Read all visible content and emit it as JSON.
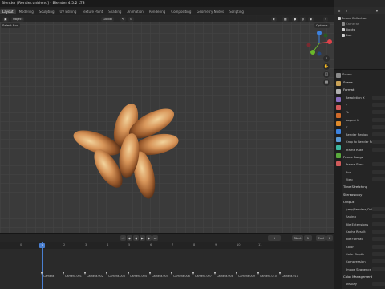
{
  "window": {
    "title": "Blender [Render.unblend] - Blender 4.5.2 LTS"
  },
  "workspace_tabs": [
    {
      "label": "Layout",
      "active": true
    },
    {
      "label": "Modeling",
      "active": false
    },
    {
      "label": "Sculpting",
      "active": false
    },
    {
      "label": "UV Editing",
      "active": false
    },
    {
      "label": "Texture Paint",
      "active": false
    },
    {
      "label": "Shading",
      "active": false
    },
    {
      "label": "Animation",
      "active": false
    },
    {
      "label": "Rendering",
      "active": false
    },
    {
      "label": "Compositing",
      "active": false
    },
    {
      "label": "Geometry Nodes",
      "active": false
    },
    {
      "label": "Scripting",
      "active": false
    }
  ],
  "viewport": {
    "header": {
      "global_label": "Global",
      "options_label": "Options"
    },
    "select_box_label": "Select Box",
    "object_menu": "Object",
    "gizmo_axes": [
      "X",
      "Y",
      "Z"
    ]
  },
  "outliner": {
    "rows": [
      {
        "label": "Scene Collection",
        "icon": "collection-icon",
        "color": "#cfcfcf"
      },
      {
        "label": "Cameras",
        "icon": "camera-icon",
        "color": "#8a8a8a"
      },
      {
        "label": "Lights",
        "icon": "light-icon",
        "color": "#cfcfcf"
      },
      {
        "label": "Bun",
        "icon": "mesh-icon",
        "color": "#cfcfcf"
      }
    ]
  },
  "properties": {
    "context": "Scene",
    "rows": [
      {
        "label": "Scene",
        "section": true
      },
      {
        "label": "Format",
        "section": true
      },
      {
        "label": "Resolution X",
        "section": false
      },
      {
        "label": "Y",
        "section": false
      },
      {
        "label": "%",
        "section": false
      },
      {
        "label": "Aspect X",
        "section": false
      },
      {
        "label": "Y",
        "section": false
      },
      {
        "label": "Render Region",
        "section": false
      },
      {
        "label": "Crop to Render Region",
        "section": false
      },
      {
        "label": "Frame Rate",
        "section": false
      },
      {
        "label": "Frame Range",
        "section": true
      },
      {
        "label": "Frame Start",
        "section": false
      },
      {
        "label": "End",
        "section": false
      },
      {
        "label": "Step",
        "section": false
      },
      {
        "label": "Time Stretching",
        "section": true
      },
      {
        "label": "Stereoscopy",
        "section": true
      },
      {
        "label": "Output",
        "section": true
      },
      {
        "label": "/tmp/Renders/Output",
        "section": false
      },
      {
        "label": "Saving",
        "section": false
      },
      {
        "label": "File Extensions",
        "section": false
      },
      {
        "label": "Cache Result",
        "section": false
      },
      {
        "label": "File Format",
        "section": false
      },
      {
        "label": "Color",
        "section": false
      },
      {
        "label": "Color Depth",
        "section": false
      },
      {
        "label": "Compression",
        "section": false
      },
      {
        "label": "Image Sequence",
        "section": false
      },
      {
        "label": "Color Management",
        "section": true
      },
      {
        "label": "Display",
        "section": false
      }
    ]
  },
  "timeline": {
    "current_frame": "1",
    "start_label": "Start",
    "start_value": "1",
    "end_label": "End",
    "end_value": "6",
    "ruler_ticks": [
      "0",
      "1",
      "2",
      "3",
      "4",
      "5",
      "6",
      "7",
      "8",
      "9",
      "10",
      "11"
    ],
    "markers": [
      "Camera",
      "Camera.001",
      "Camera.002",
      "Camera.003",
      "Camera.004",
      "Camera.005",
      "Camera.006",
      "Camera.007",
      "Camera.008",
      "Camera.009",
      "Camera.010",
      "Camera.011"
    ]
  },
  "colors": {
    "accent": "#4a7fd0",
    "viewport_bg": "#3a3a3a",
    "axis_x": "#e0424a",
    "axis_y": "#6ab82b",
    "axis_z": "#3c82e0"
  }
}
